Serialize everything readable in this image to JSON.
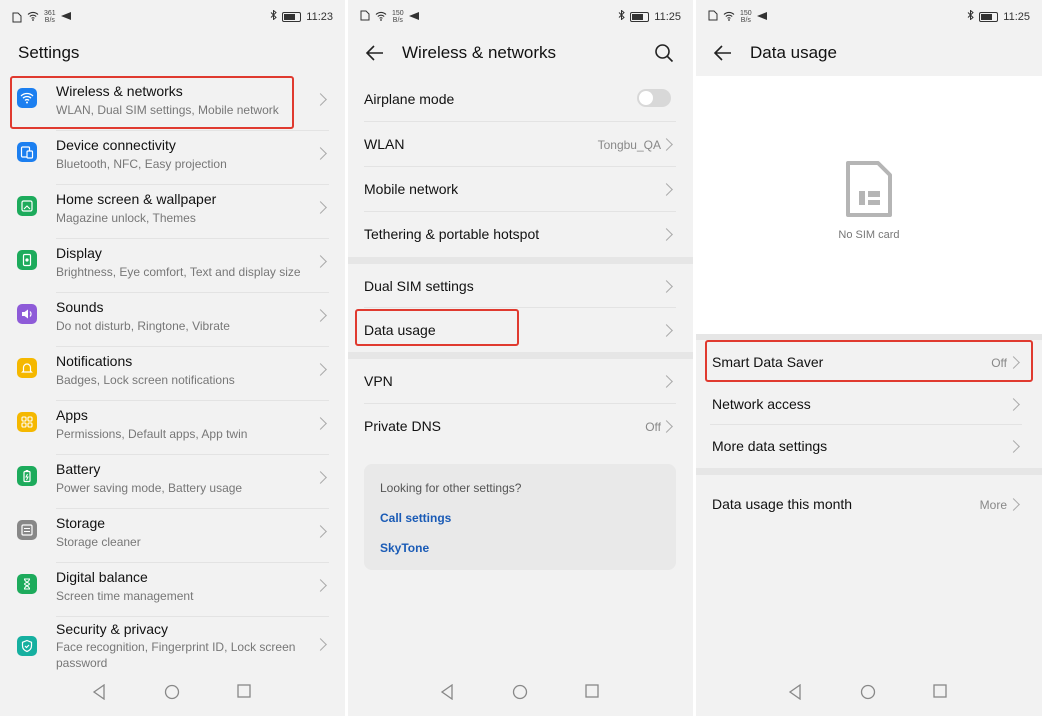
{
  "colors": {
    "highlight": "#e03a2f",
    "link": "#1a5bb6"
  },
  "panels": [
    {
      "status": {
        "speed_top": "361",
        "speed_unit": "B/s",
        "time": "11:23"
      },
      "title": "Settings",
      "items": [
        {
          "title": "Wireless & networks",
          "sub": "WLAN, Dual SIM settings, Mobile network",
          "icon": "wifi-icon",
          "color": "#1c7ff0"
        },
        {
          "title": "Device connectivity",
          "sub": "Bluetooth, NFC, Easy projection",
          "icon": "device-connectivity-icon",
          "color": "#1c7ff0"
        },
        {
          "title": "Home screen & wallpaper",
          "sub": "Magazine unlock, Themes",
          "icon": "wallpaper-icon",
          "color": "#1dab5c"
        },
        {
          "title": "Display",
          "sub": "Brightness, Eye comfort, Text and display size",
          "icon": "display-icon",
          "color": "#1dab5c"
        },
        {
          "title": "Sounds",
          "sub": "Do not disturb, Ringtone, Vibrate",
          "icon": "sound-icon",
          "color": "#8e5bd8"
        },
        {
          "title": "Notifications",
          "sub": "Badges, Lock screen notifications",
          "icon": "notification-icon",
          "color": "#f5b800"
        },
        {
          "title": "Apps",
          "sub": "Permissions, Default apps, App twin",
          "icon": "apps-icon",
          "color": "#f5b800"
        },
        {
          "title": "Battery",
          "sub": "Power saving mode, Battery usage",
          "icon": "battery-icon",
          "color": "#1dab5c"
        },
        {
          "title": "Storage",
          "sub": "Storage cleaner",
          "icon": "storage-icon",
          "color": "#888888"
        },
        {
          "title": "Digital balance",
          "sub": "Screen time management",
          "icon": "hourglass-icon",
          "color": "#1dab5c"
        },
        {
          "title": "Security & privacy",
          "sub": "Face recognition, Fingerprint ID, Lock screen password",
          "icon": "shield-icon",
          "color": "#16b0a0"
        }
      ]
    },
    {
      "status": {
        "speed_top": "150",
        "speed_unit": "B/s",
        "time": "11:25"
      },
      "title": "Wireless & networks",
      "rows": {
        "airplane": "Airplane mode",
        "wlan": "WLAN",
        "wlan_value": "Tongbu_QA",
        "mobile": "Mobile network",
        "tethering": "Tethering & portable hotspot",
        "dual_sim": "Dual SIM settings",
        "data_usage": "Data usage",
        "vpn": "VPN",
        "private_dns": "Private DNS",
        "private_dns_value": "Off"
      },
      "suggest": {
        "title": "Looking for other settings?",
        "links": [
          "Call settings",
          "SkyTone"
        ]
      }
    },
    {
      "status": {
        "speed_top": "150",
        "speed_unit": "B/s",
        "time": "11:25"
      },
      "title": "Data usage",
      "sim_label": "No SIM card",
      "rows": {
        "smart_saver": "Smart Data Saver",
        "smart_saver_value": "Off",
        "network_access": "Network access",
        "more_settings": "More data settings",
        "this_month": "Data usage this month",
        "this_month_value": "More"
      }
    }
  ]
}
